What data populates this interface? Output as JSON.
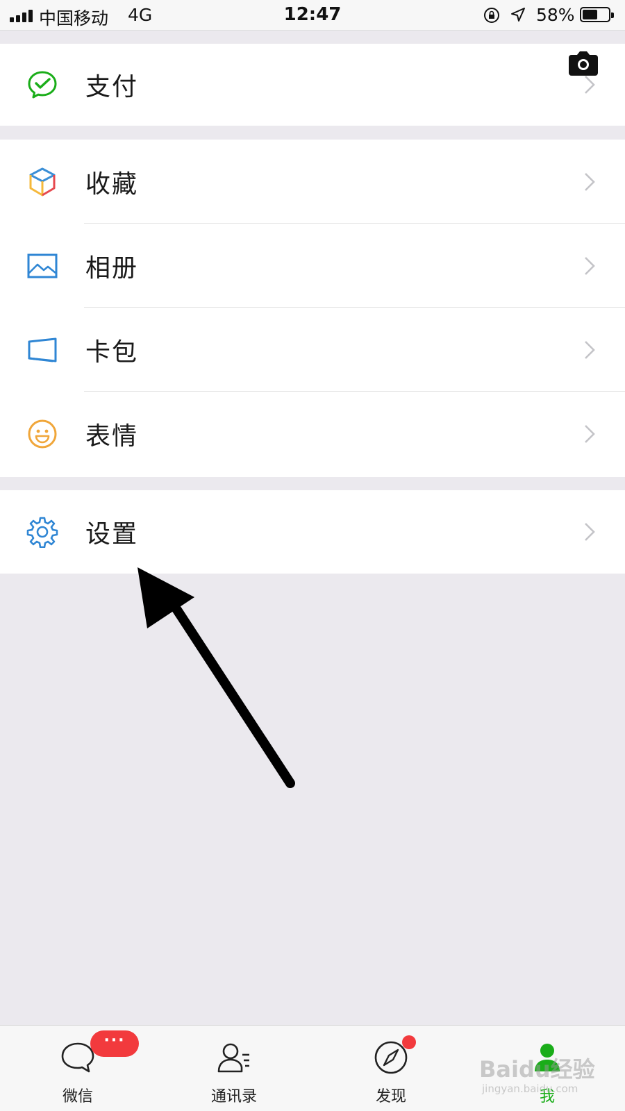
{
  "status_bar": {
    "carrier": "中国移动",
    "network": "4G",
    "time": "12:47",
    "battery_percent": "58%",
    "battery_level": 0.58
  },
  "menu": {
    "pay": {
      "label": "支付",
      "icon": "wechat-pay-icon"
    },
    "items": [
      {
        "label": "收藏",
        "icon": "favorites-cube-icon"
      },
      {
        "label": "相册",
        "icon": "album-picture-icon"
      },
      {
        "label": "卡包",
        "icon": "card-wallet-icon"
      },
      {
        "label": "表情",
        "icon": "sticker-smiley-icon"
      }
    ],
    "settings": {
      "label": "设置",
      "icon": "gear-icon"
    }
  },
  "tabs": [
    {
      "label": "微信",
      "icon": "chat-bubble-icon",
      "badge": "···"
    },
    {
      "label": "通讯录",
      "icon": "contacts-icon"
    },
    {
      "label": "发现",
      "icon": "compass-icon",
      "dot": true
    },
    {
      "label": "我",
      "icon": "me-person-icon",
      "active": true
    }
  ],
  "watermark": {
    "text": "Baidu经验",
    "sub": "jingyan.baidu.com"
  },
  "colors": {
    "accent_green": "#1aad19",
    "badge_red": "#f23a3d",
    "background": "#ebe9ee"
  }
}
